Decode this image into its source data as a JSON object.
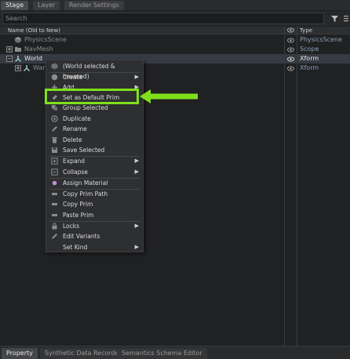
{
  "top_tabs": [
    {
      "label": "Stage",
      "active": true
    },
    {
      "label": "Layer",
      "active": false
    },
    {
      "label": "Render Settings",
      "active": false
    }
  ],
  "search": {
    "placeholder": "Search"
  },
  "header": {
    "name_col": "Name (Old to New)",
    "type_col": "Type"
  },
  "rows": [
    {
      "label": "PhysicsScene",
      "type": "PhysicsScene",
      "icon": "physics-scene-icon",
      "expander": ""
    },
    {
      "label": "NavMesh",
      "type": "Scope",
      "icon": "folder-icon",
      "expander": "+"
    },
    {
      "label": "World",
      "type": "Xform",
      "icon": "xform-icon",
      "expander": "−",
      "selected": true
    },
    {
      "label": "Wars",
      "type": "Xform",
      "icon": "xform-icon",
      "expander": "+"
    }
  ],
  "context_menu": {
    "items": [
      {
        "label": "(World selected & hovered)",
        "icon": "prim-icon"
      },
      {
        "label": "Create",
        "icon": "create-icon",
        "submenu": true
      },
      {
        "label": "Add",
        "icon": "add-icon",
        "submenu": true
      },
      {
        "label": "Set as Default Prim",
        "icon": "pin-icon"
      },
      {
        "label": "Group Selected",
        "icon": "group-icon"
      },
      {
        "label": "Duplicate",
        "icon": "duplicate-icon"
      },
      {
        "label": "Rename",
        "icon": "rename-icon"
      },
      {
        "label": "Delete",
        "icon": "trash-icon"
      },
      {
        "label": "Save Selected",
        "icon": "save-icon"
      },
      {
        "label": "Expand",
        "icon": "expand-icon",
        "submenu": true
      },
      {
        "label": "Collapse",
        "icon": "collapse-icon",
        "submenu": true
      },
      {
        "label": "Assign Material",
        "icon": "material-icon"
      },
      {
        "label": "Copy Prim Path",
        "icon": "copy-path-icon"
      },
      {
        "label": "Copy Prim",
        "icon": "copy-icon"
      },
      {
        "label": "Paste Prim",
        "icon": "paste-icon"
      },
      {
        "label": "Locks",
        "icon": "lock-icon",
        "submenu": true
      },
      {
        "label": "Edit Variants",
        "icon": "variants-icon"
      },
      {
        "label": "Set Kind",
        "icon": "",
        "submenu": true
      }
    ]
  },
  "bottom_tabs": [
    {
      "label": "Property",
      "active": true
    },
    {
      "label": "Synthetic Data Recorder",
      "active": false
    },
    {
      "label": "Semantics Schema Editor",
      "active": false
    }
  ],
  "colors": {
    "accent": "#7fe01a",
    "selection": "#363b43"
  }
}
